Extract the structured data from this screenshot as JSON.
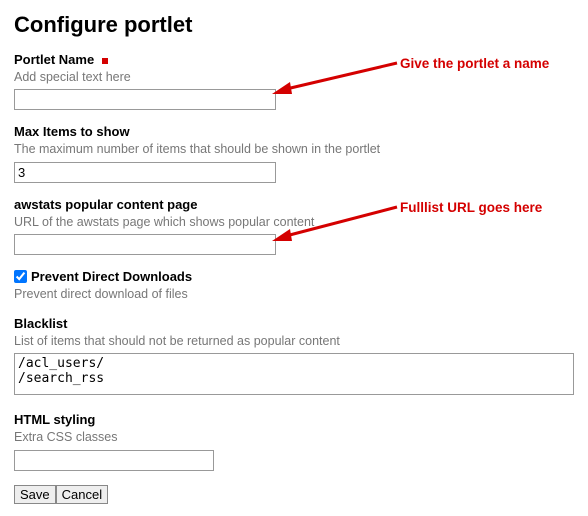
{
  "title": "Configure portlet",
  "fields": {
    "portletName": {
      "label": "Portlet Name",
      "help": "Add special text here",
      "value": ""
    },
    "maxItems": {
      "label": "Max Items to show",
      "help": "The maximum number of items that should be shown in the portlet",
      "value": "3"
    },
    "awstatsPage": {
      "label": "awstats popular content page",
      "help": "URL of the awstats page which shows popular content",
      "value": ""
    },
    "preventDownloads": {
      "label": "Prevent Direct Downloads",
      "help": "Prevent direct download of files",
      "checked": true
    },
    "blacklist": {
      "label": "Blacklist",
      "help": "List of items that should not be returned as popular content",
      "value": "/acl_users/\n/search_rss"
    },
    "htmlStyling": {
      "label": "HTML styling",
      "help": "Extra CSS classes",
      "value": ""
    }
  },
  "buttons": {
    "save": "Save",
    "cancel": "Cancel"
  },
  "annotations": {
    "name": "Give the portlet a name",
    "url": "Fulllist  URL goes here"
  }
}
